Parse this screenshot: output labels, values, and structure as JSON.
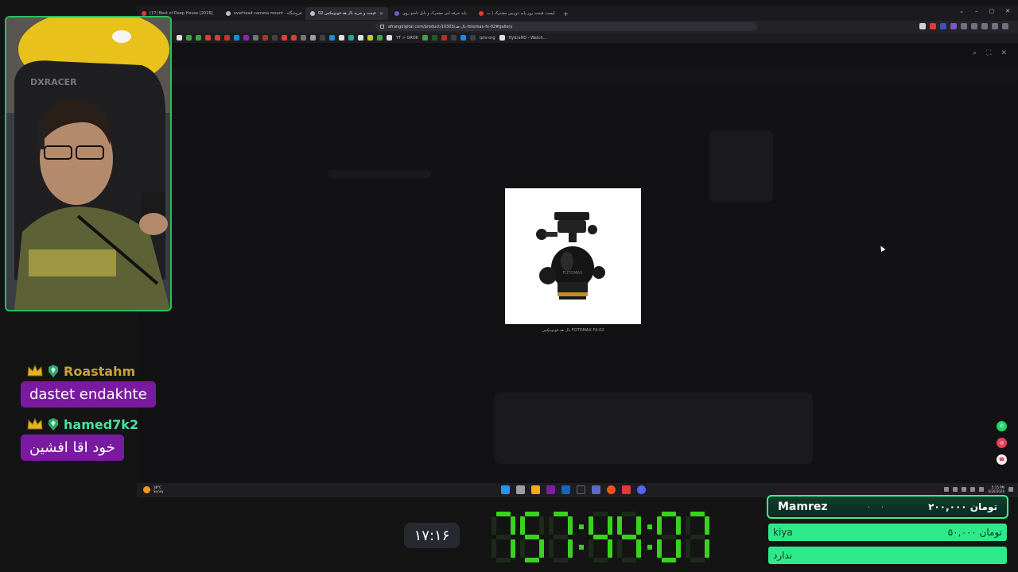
{
  "browser": {
    "tabs": [
      {
        "label": "(17) Best of Deep House [2026]",
        "active": false,
        "icon": "youtube-icon",
        "color": "#e53935"
      },
      {
        "label": "overhead camera mount - فروشگاه",
        "active": false,
        "icon": "globe-icon",
        "color": "#bdbdbd"
      },
      {
        "label": "قیمت و خرید بال هد فوتومکس 02",
        "active": true,
        "icon": "globe-icon",
        "color": "#bdbdbd"
      },
      {
        "label": "پایه حرفه ایی مشترک و تابل تاشو روی",
        "active": false,
        "icon": "page-icon",
        "color": "#7e57c2"
      },
      {
        "label": "لیست قیمت روز پایه دوربین مشترک | ب",
        "active": false,
        "icon": "opera-icon",
        "color": "#e53935"
      }
    ],
    "new_tab": "+",
    "window_controls": {
      "dropdown": "⌄",
      "minimize": "–",
      "maximize": "▢",
      "close": "✕"
    },
    "url": "afrangdigital.com/product/10303/بال-هد-fotomax-fx-02#gallery",
    "bookmarks": {
      "grok_label": "YT > GROK",
      "iptv_label": "iptv-org",
      "hydrahd_label": "HydraHD - Watch..."
    },
    "lightbox_tools": {
      "zoom": "⌕",
      "fullscreen": "⛶",
      "close": "✕"
    },
    "product_caption": "بال هد فوتومکس FOTOMAX FX-02",
    "socials": [
      {
        "name": "whatsapp",
        "color": "#25d366",
        "glyph": "✆"
      },
      {
        "name": "instagram",
        "color": "#e4405f",
        "glyph": "◎"
      },
      {
        "name": "phone",
        "color": "#f2f2f2",
        "glyph": "☎"
      }
    ],
    "taskbar": {
      "temperature": "38°C",
      "weather": "Sunny",
      "time": "5:15 PM",
      "date": "6/20/2026"
    }
  },
  "chat": [
    {
      "user": "Roastahm",
      "user_color": "#c9a23a",
      "message": "dastet endakhte"
    },
    {
      "user": "hamed7k2",
      "user_color": "#4be0a0",
      "message": "خود اقا افشین"
    }
  ],
  "clock": "۱۷:۱۶",
  "countdown": {
    "value": "757:44:07",
    "color": "#39d21e"
  },
  "donations": {
    "top": {
      "name": "Mamrez",
      "amount": "۲۰۰,۰۰۰ تومان"
    },
    "rows": [
      {
        "name": "kiya",
        "amount": "۵۰,۰۰۰ تومان"
      },
      {
        "name": "ندارد",
        "amount": ""
      }
    ]
  }
}
